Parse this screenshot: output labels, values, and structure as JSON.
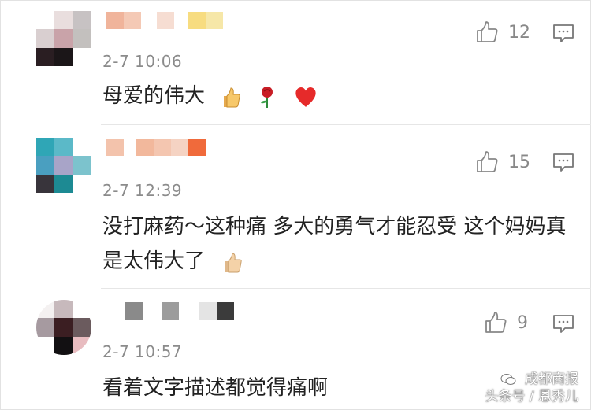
{
  "comments": [
    {
      "time": "2-7 10:06",
      "text": "母爱的伟大",
      "likes": "12",
      "emojis": [
        "thumbs-up-emoji",
        "rose-emoji",
        "heart-emoji"
      ]
    },
    {
      "time": "2-7 12:39",
      "text": "没打麻药～这种痛 多大的勇气才能忍受 这个妈妈真是太伟大了",
      "likes": "15",
      "emojis": [
        "thumbs-up-emoji"
      ]
    },
    {
      "time": "2-7 10:57",
      "text": "看着文字描述都觉得痛啊",
      "likes": "9",
      "emojis": []
    }
  ],
  "watermark": {
    "line1": "成都商报",
    "line2": "头条号 / 恩秀儿"
  },
  "colors": {
    "text": "#222222",
    "meta": "#8b8b8b",
    "divider": "#e6e6e6"
  }
}
